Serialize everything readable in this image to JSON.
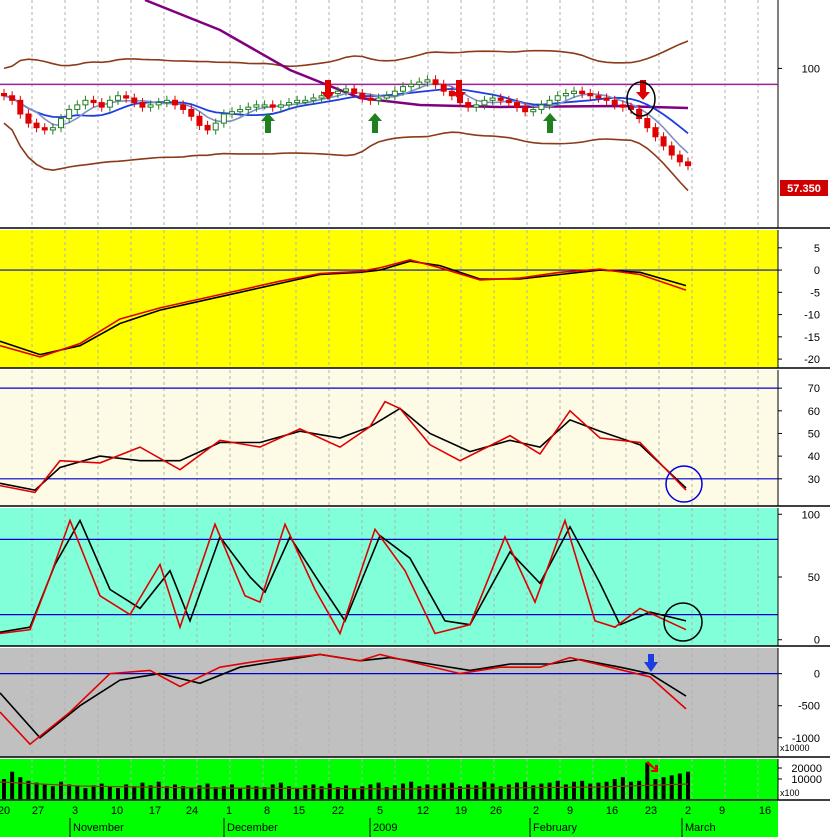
{
  "chart_data": {
    "type": "line",
    "title": "",
    "last_price_tag": "57.350",
    "volume_multiplier_label": "x100",
    "momentum_multiplier_label": "x10000",
    "x_ticks": [
      "20",
      "27",
      "3",
      "10",
      "17",
      "24",
      "1",
      "8",
      "15",
      "22",
      "5",
      "12",
      "19",
      "26",
      "2",
      "9",
      "16",
      "23",
      "2",
      "9",
      "16"
    ],
    "month_labels": [
      "November",
      "December",
      "2009",
      "February",
      "March"
    ],
    "panels": [
      {
        "name": "price",
        "type": "candlestick",
        "y_ticks": [
          "100"
        ],
        "ylim": [
          30,
          130
        ],
        "overlays": [
          "bollinger-upper",
          "bollinger-lower",
          "moving-average-long",
          "moving-average-mid",
          "moving-average-short",
          "resistance-line"
        ],
        "resistance_level": 93,
        "buy_arrows": 4,
        "sell_arrows": 4,
        "close_series": [
          88,
          86,
          80,
          76,
          74,
          73,
          74,
          78,
          82,
          84,
          86,
          85,
          83,
          86,
          88,
          87,
          85,
          83,
          84,
          85,
          86,
          84,
          82,
          79,
          75,
          73,
          76,
          80,
          81,
          82,
          83,
          84,
          84,
          83,
          84,
          85,
          86,
          86,
          87,
          88,
          89,
          90,
          91,
          89,
          87,
          86,
          87,
          88,
          90,
          92,
          93,
          94,
          95,
          93,
          90,
          88,
          85,
          83,
          84,
          86,
          87,
          86,
          85,
          83,
          81,
          82,
          84,
          86,
          88,
          89,
          90,
          89,
          88,
          87,
          86,
          84,
          83,
          82,
          78,
          74,
          70,
          66,
          62,
          59,
          57.35
        ]
      },
      {
        "name": "macd",
        "background": "#ffff00",
        "y_ticks": [
          "5",
          "0",
          "-5",
          "-10",
          "-15",
          "-20"
        ],
        "ylim": [
          -22,
          9
        ],
        "series": [
          {
            "color": "#000000",
            "values": [
              [
                0,
                -16
              ],
              [
                40,
                -19
              ],
              [
                80,
                -17
              ],
              [
                120,
                -12
              ],
              [
                160,
                -9
              ],
              [
                200,
                -7
              ],
              [
                240,
                -5
              ],
              [
                280,
                -3
              ],
              [
                320,
                -1
              ],
              [
                360,
                -0.5
              ],
              [
                380,
                0
              ],
              [
                410,
                2
              ],
              [
                440,
                1
              ],
              [
                480,
                -2
              ],
              [
                520,
                -2
              ],
              [
                560,
                -1
              ],
              [
                600,
                0
              ],
              [
                640,
                -0.5
              ],
              [
                686,
                -3.5
              ]
            ]
          },
          {
            "color": "#e00000",
            "values": [
              [
                0,
                -17
              ],
              [
                40,
                -19.5
              ],
              [
                80,
                -16.5
              ],
              [
                120,
                -11
              ],
              [
                160,
                -8.5
              ],
              [
                200,
                -6.5
              ],
              [
                240,
                -4.5
              ],
              [
                280,
                -2.5
              ],
              [
                320,
                -0.8
              ],
              [
                360,
                -0.3
              ],
              [
                380,
                0.5
              ],
              [
                410,
                2.3
              ],
              [
                440,
                0.5
              ],
              [
                480,
                -2.2
              ],
              [
                520,
                -1.8
              ],
              [
                560,
                -0.5
              ],
              [
                600,
                0.2
              ],
              [
                640,
                -1
              ],
              [
                686,
                -4.5
              ]
            ]
          }
        ]
      },
      {
        "name": "rsi",
        "background": "#fdfbe6",
        "y_ticks": [
          "70",
          "60",
          "50",
          "40",
          "30"
        ],
        "ylim": [
          18,
          78
        ],
        "levels": [
          30,
          70
        ],
        "series": [
          {
            "color": "#000000",
            "values": [
              [
                0,
                28
              ],
              [
                35,
                25
              ],
              [
                60,
                35
              ],
              [
                100,
                40
              ],
              [
                140,
                38
              ],
              [
                180,
                38
              ],
              [
                220,
                46
              ],
              [
                260,
                46
              ],
              [
                300,
                51
              ],
              [
                340,
                48
              ],
              [
                370,
                53
              ],
              [
                400,
                61
              ],
              [
                430,
                50
              ],
              [
                470,
                42
              ],
              [
                510,
                47
              ],
              [
                540,
                44
              ],
              [
                570,
                56
              ],
              [
                600,
                51
              ],
              [
                640,
                45
              ],
              [
                686,
                26
              ]
            ]
          },
          {
            "color": "#e00000",
            "values": [
              [
                0,
                27
              ],
              [
                35,
                24
              ],
              [
                60,
                38
              ],
              [
                100,
                37
              ],
              [
                140,
                44
              ],
              [
                180,
                34
              ],
              [
                220,
                47
              ],
              [
                260,
                44
              ],
              [
                300,
                52
              ],
              [
                340,
                44
              ],
              [
                370,
                53
              ],
              [
                385,
                64
              ],
              [
                400,
                61
              ],
              [
                430,
                45
              ],
              [
                460,
                38
              ],
              [
                510,
                49
              ],
              [
                540,
                41
              ],
              [
                570,
                60
              ],
              [
                600,
                48
              ],
              [
                640,
                46
              ],
              [
                686,
                25
              ]
            ]
          }
        ]
      },
      {
        "name": "stochastic",
        "background": "#80ffd8",
        "y_ticks": [
          "100",
          "50",
          "0"
        ],
        "ylim": [
          -5,
          105
        ],
        "levels": [
          20,
          80
        ],
        "series": [
          {
            "color": "#000000",
            "values": [
              [
                0,
                6
              ],
              [
                30,
                10
              ],
              [
                55,
                60
              ],
              [
                80,
                95
              ],
              [
                110,
                40
              ],
              [
                140,
                25
              ],
              [
                170,
                55
              ],
              [
                190,
                15
              ],
              [
                220,
                82
              ],
              [
                250,
                50
              ],
              [
                265,
                38
              ],
              [
                290,
                82
              ],
              [
                320,
                45
              ],
              [
                345,
                15
              ],
              [
                380,
                83
              ],
              [
                410,
                65
              ],
              [
                445,
                15
              ],
              [
                470,
                12
              ],
              [
                510,
                70
              ],
              [
                540,
                45
              ],
              [
                570,
                90
              ],
              [
                600,
                45
              ],
              [
                620,
                12
              ],
              [
                650,
                22
              ],
              [
                686,
                15
              ]
            ]
          },
          {
            "color": "#e00000",
            "values": [
              [
                0,
                5
              ],
              [
                30,
                8
              ],
              [
                50,
                50
              ],
              [
                70,
                95
              ],
              [
                100,
                35
              ],
              [
                130,
                20
              ],
              [
                160,
                60
              ],
              [
                180,
                10
              ],
              [
                215,
                92
              ],
              [
                245,
                35
              ],
              [
                260,
                30
              ],
              [
                285,
                92
              ],
              [
                315,
                40
              ],
              [
                340,
                5
              ],
              [
                375,
                88
              ],
              [
                405,
                55
              ],
              [
                435,
                5
              ],
              [
                470,
                12
              ],
              [
                505,
                82
              ],
              [
                535,
                30
              ],
              [
                565,
                95
              ],
              [
                595,
                15
              ],
              [
                615,
                10
              ],
              [
                640,
                25
              ],
              [
                686,
                8
              ]
            ]
          }
        ]
      },
      {
        "name": "momentum",
        "background": "#c0c0c0",
        "y_ticks": [
          "0",
          "-500",
          "-1000"
        ],
        "ylim": [
          -1300,
          400
        ],
        "levels": [
          0
        ],
        "series": [
          {
            "color": "#000000",
            "values": [
              [
                0,
                -300
              ],
              [
                40,
                -1000
              ],
              [
                80,
                -500
              ],
              [
                120,
                -100
              ],
              [
                160,
                0
              ],
              [
                200,
                -150
              ],
              [
                240,
                100
              ],
              [
                280,
                200
              ],
              [
                320,
                300
              ],
              [
                360,
                200
              ],
              [
                390,
                250
              ],
              [
                430,
                150
              ],
              [
                470,
                50
              ],
              [
                510,
                150
              ],
              [
                550,
                150
              ],
              [
                580,
                220
              ],
              [
                620,
                100
              ],
              [
                650,
                0
              ],
              [
                686,
                -350
              ]
            ]
          },
          {
            "color": "#e00000",
            "values": [
              [
                0,
                -600
              ],
              [
                30,
                -1100
              ],
              [
                70,
                -600
              ],
              [
                110,
                0
              ],
              [
                150,
                50
              ],
              [
                180,
                -200
              ],
              [
                220,
                100
              ],
              [
                260,
                200
              ],
              [
                320,
                300
              ],
              [
                360,
                200
              ],
              [
                380,
                300
              ],
              [
                420,
                150
              ],
              [
                460,
                0
              ],
              [
                500,
                100
              ],
              [
                540,
                100
              ],
              [
                570,
                250
              ],
              [
                610,
                100
              ],
              [
                650,
                -50
              ],
              [
                686,
                -550
              ]
            ]
          }
        ]
      },
      {
        "name": "volume",
        "background": "#00ff00",
        "y_ticks": [
          "20000",
          "10000"
        ],
        "bars": [
          110,
          150,
          120,
          100,
          90,
          80,
          70,
          95,
          80,
          70,
          60,
          75,
          85,
          70,
          60,
          80,
          70,
          90,
          75,
          95,
          70,
          80,
          70,
          60,
          75,
          85,
          65,
          70,
          80,
          60,
          75,
          70,
          65,
          80,
          90,
          70,
          60,
          75,
          80,
          70,
          85,
          65,
          75,
          60,
          70,
          80,
          90,
          65,
          75,
          85,
          95,
          70,
          80,
          75,
          85,
          90,
          70,
          80,
          75,
          95,
          85,
          70,
          80,
          90,
          95,
          75,
          85,
          90,
          100,
          80,
          95,
          100,
          85,
          90,
          95,
          110,
          120,
          95,
          100,
          200,
          110,
          120,
          130,
          140,
          150
        ],
        "signal_arrow": "red"
      }
    ]
  }
}
